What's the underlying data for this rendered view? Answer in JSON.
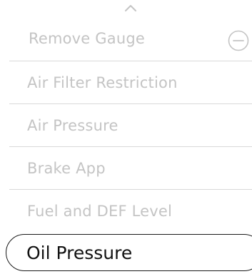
{
  "menu": {
    "items": [
      {
        "label": "Remove Gauge",
        "action_icon": "minus-circle-icon"
      },
      {
        "label": "Air Filter Restriction"
      },
      {
        "label": "Air Pressure"
      },
      {
        "label": "Brake App"
      },
      {
        "label": "Fuel and DEF Level"
      }
    ],
    "selected": {
      "label": "Oil Pressure"
    }
  },
  "colors": {
    "inactive_text": "#c4c4c4",
    "divider": "#d9d9d9",
    "selected_text": "#111111",
    "selected_border": "#1a1a1a"
  }
}
